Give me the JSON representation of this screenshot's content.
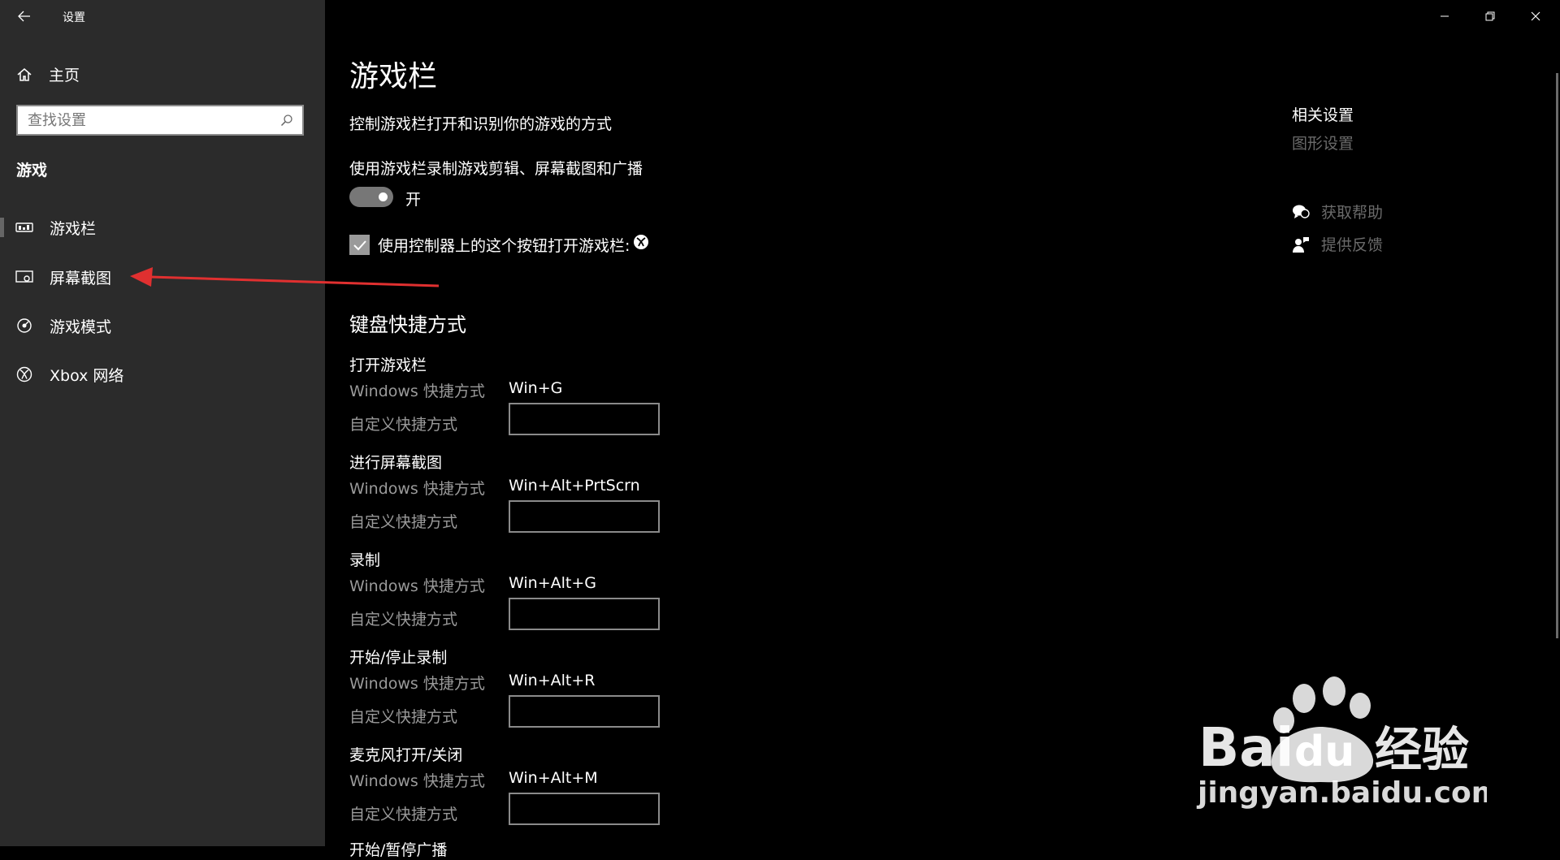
{
  "window": {
    "title": "设置"
  },
  "sidebar": {
    "home_label": "主页",
    "search_placeholder": "查找设置",
    "section_title": "游戏",
    "items": [
      {
        "label": "游戏栏",
        "icon": "game-bar-icon",
        "selected": true
      },
      {
        "label": "屏幕截图",
        "icon": "captures-icon",
        "selected": false
      },
      {
        "label": "游戏模式",
        "icon": "game-mode-icon",
        "selected": false
      },
      {
        "label": "Xbox 网络",
        "icon": "xbox-icon",
        "selected": false
      }
    ]
  },
  "main": {
    "title": "游戏栏",
    "description": "控制游戏栏打开和识别你的游戏的方式",
    "toggle_label": "使用游戏栏录制游戏剪辑、屏幕截图和广播",
    "toggle_state": "开",
    "checkbox_label": "使用控制器上的这个按钮打开游戏栏:",
    "shortcuts_heading": "键盘快捷方式",
    "windows_shortcut_label": "Windows 快捷方式",
    "custom_shortcut_label": "自定义快捷方式",
    "shortcuts": [
      {
        "name": "打开游戏栏",
        "keys": "Win+G",
        "custom": ""
      },
      {
        "name": "进行屏幕截图",
        "keys": "Win+Alt+PrtScrn",
        "custom": ""
      },
      {
        "name": "录制",
        "keys": "Win+Alt+G",
        "custom": ""
      },
      {
        "name": "开始/停止录制",
        "keys": "Win+Alt+R",
        "custom": ""
      },
      {
        "name": "麦克风打开/关闭",
        "keys": "Win+Alt+M",
        "custom": ""
      }
    ],
    "partial_next": "开始/暂停广播"
  },
  "related": {
    "heading": "相关设置",
    "graphics_link": "图形设置",
    "help_link": "获取帮助",
    "feedback_link": "提供反馈"
  },
  "watermark": {
    "brand_text": "Bai",
    "brand_du": "du",
    "brand_cn": "经验",
    "url": "jingyan.baidu.com"
  },
  "colors": {
    "sidebar_bg": "#2b2b2b",
    "main_bg": "#000000",
    "annotation_arrow": "#e03030"
  }
}
